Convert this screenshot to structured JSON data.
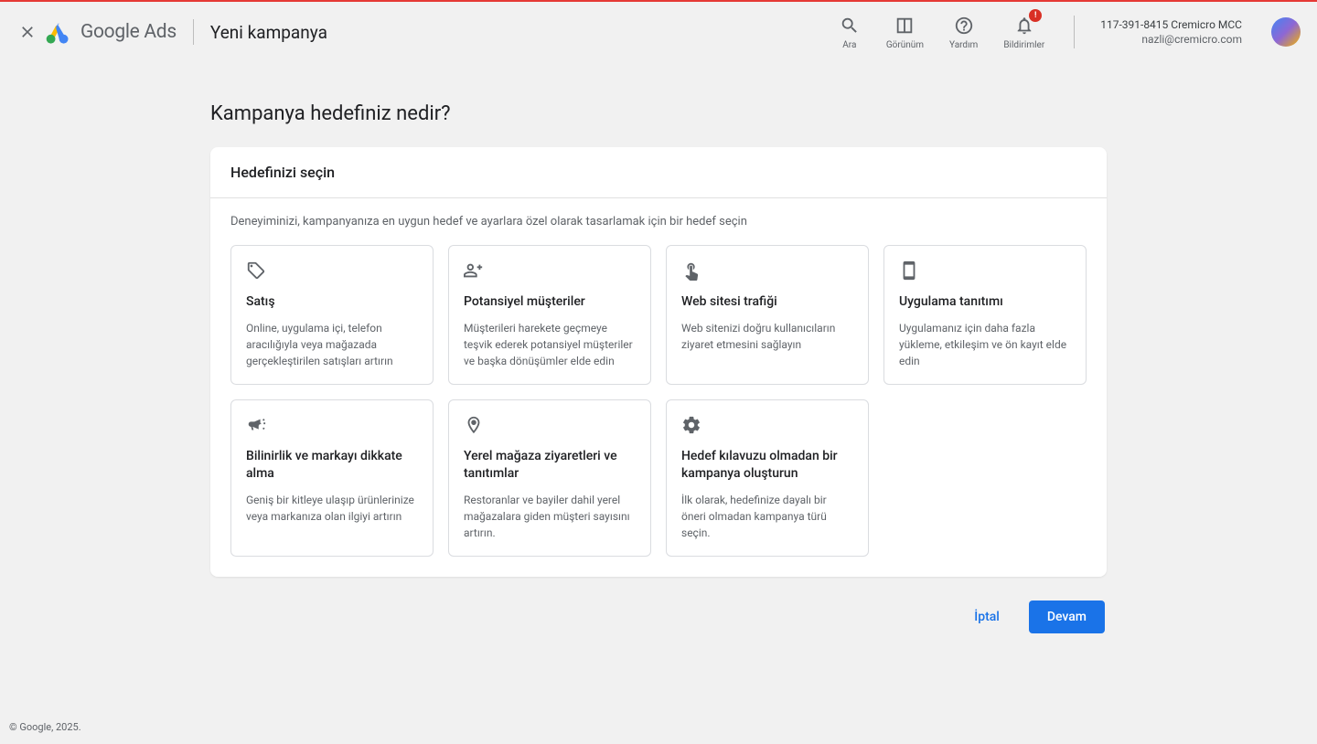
{
  "header": {
    "brand": "Google Ads",
    "page_title": "Yeni kampanya",
    "icons": {
      "search": "Ara",
      "view": "Görünüm",
      "help": "Yardım",
      "notifications": "Bildirimler"
    },
    "account": {
      "name": "117-391-8415 Cremicro MCC",
      "email": "nazli@cremicro.com"
    }
  },
  "main": {
    "question": "Kampanya hedefiniz nedir?",
    "card_title": "Hedefinizi seçin",
    "description": "Deneyiminizi, kampanyanıza en uygun hedef ve ayarlara özel olarak tasarlamak için bir hedef seçin",
    "goals": [
      {
        "title": "Satış",
        "desc": "Online, uygulama içi, telefon aracılığıyla veya mağazada gerçekleştirilen satışları artırın"
      },
      {
        "title": "Potansiyel müşteriler",
        "desc": "Müşterileri harekete geçmeye teşvik ederek potansiyel müşteriler ve başka dönüşümler elde edin"
      },
      {
        "title": "Web sitesi trafiği",
        "desc": "Web sitenizi doğru kullanıcıların ziyaret etmesini sağlayın"
      },
      {
        "title": "Uygulama tanıtımı",
        "desc": "Uygulamanız için daha fazla yükleme, etkileşim ve ön kayıt elde edin"
      },
      {
        "title": "Bilinirlik ve markayı dikkate alma",
        "desc": "Geniş bir kitleye ulaşıp ürünlerinize veya markanıza olan ilgiyi artırın"
      },
      {
        "title": "Yerel mağaza ziyaretleri ve tanıtımlar",
        "desc": "Restoranlar ve bayiler dahil yerel mağazalara giden müşteri sayısını artırın."
      },
      {
        "title": "Hedef kılavuzu olmadan bir kampanya oluşturun",
        "desc": "İlk olarak, hedefinize dayalı bir öneri olmadan kampanya türü seçin."
      }
    ],
    "buttons": {
      "cancel": "İptal",
      "continue": "Devam"
    }
  },
  "footer": "© Google, 2025."
}
